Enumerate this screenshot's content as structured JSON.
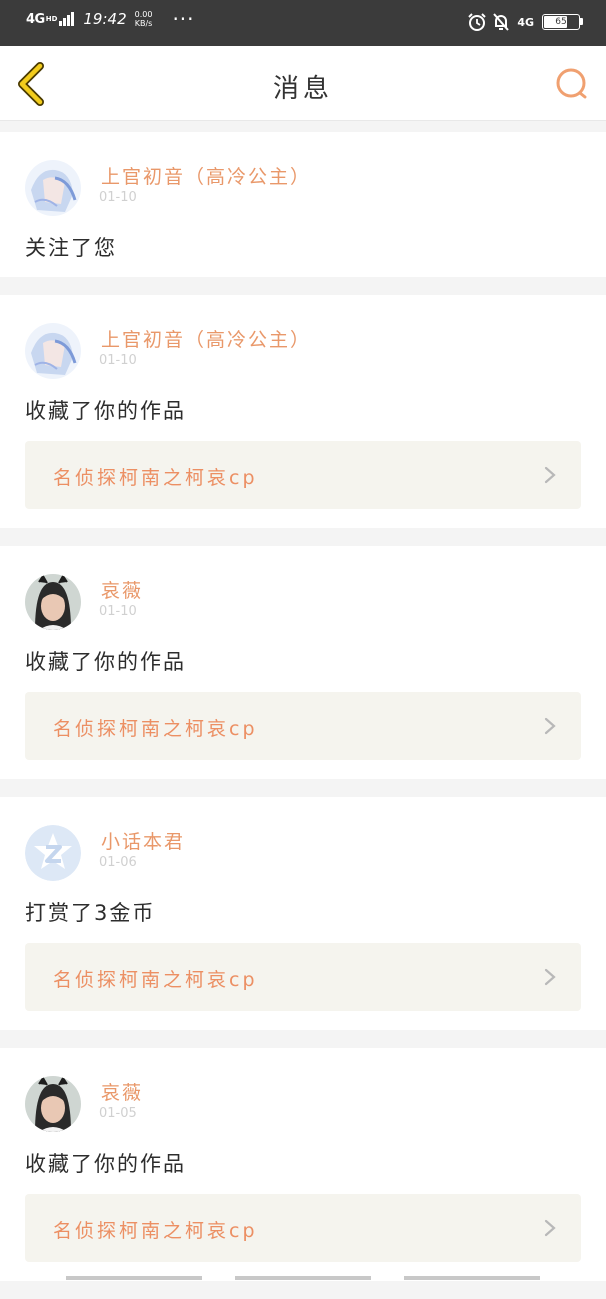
{
  "status_bar": {
    "network": "4G",
    "network_sup": "HD",
    "time": "19:42",
    "speed_value": "0.00",
    "speed_unit": "KB/s",
    "more": "···",
    "right_network": "4G",
    "battery": "65"
  },
  "header": {
    "title": "消息",
    "back_icon": "chevron-left-icon",
    "search_icon": "search-icon"
  },
  "colors": {
    "accent": "#e9986a",
    "work_title": "#ec8f63",
    "card_bg": "#f5f4ee",
    "back_icon": "#e6c000"
  },
  "messages": [
    {
      "username": "上官初音（高冷公主）",
      "time": "01-10",
      "text": "关注了您",
      "avatar": "anime-girl-avatar"
    },
    {
      "username": "上官初音（高冷公主）",
      "time": "01-10",
      "text": "收藏了你的作品",
      "avatar": "anime-girl-avatar",
      "work": "名侦探柯南之柯哀cp"
    },
    {
      "username": "哀薇",
      "time": "01-10",
      "text": "收藏了你的作品",
      "avatar": "girl-photo-avatar",
      "work": "名侦探柯南之柯哀cp"
    },
    {
      "username": "小话本君",
      "time": "01-06",
      "text": "打赏了3金币",
      "avatar": "z-logo-avatar",
      "work": "名侦探柯南之柯哀cp"
    },
    {
      "username": "哀薇",
      "time": "01-05",
      "text": "收藏了你的作品",
      "avatar": "girl-photo-avatar",
      "work": "名侦探柯南之柯哀cp"
    }
  ]
}
